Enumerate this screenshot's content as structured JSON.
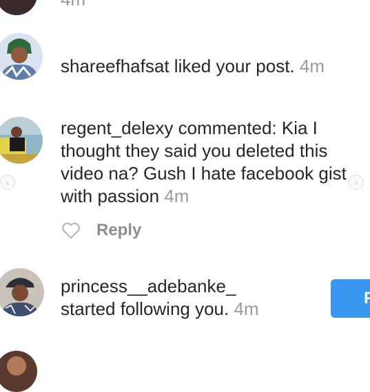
{
  "notifications": [
    {
      "username": "",
      "action": "",
      "time": "4m",
      "partial": true
    },
    {
      "username": "shareefhafsat",
      "action": " liked your post.",
      "time": "4m"
    },
    {
      "username": "regent_delexy",
      "action": " commented: Kia I thought they said you deleted this video na?  Gush I hate facebook gist with passion",
      "time": "4m",
      "reply_label": "Reply"
    },
    {
      "username": "princess__adebanke_",
      "action": "started following you.",
      "time": "4m",
      "button_label": "F"
    }
  ],
  "icons": {
    "like": "heart-outline-icon",
    "prev": "chevron-left-icon",
    "next": "chevron-right-icon"
  },
  "colors": {
    "follow_button": "#3897f0",
    "timestamp": "#9a9a9a",
    "reply": "#8e8e8e"
  }
}
